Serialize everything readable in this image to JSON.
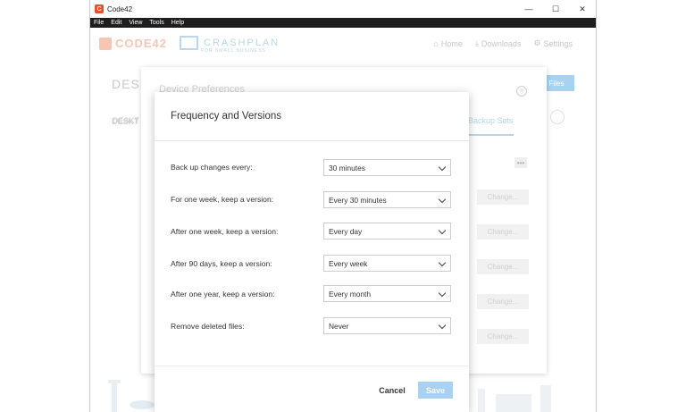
{
  "window": {
    "title": "Code42",
    "icon_label": "C",
    "controls": {
      "minimize": "—",
      "maximize": "☐",
      "close": "✕"
    }
  },
  "menu": [
    "File",
    "Edit",
    "View",
    "Tools",
    "Help"
  ],
  "header": {
    "logo": "CODE42",
    "product": "CRASHPLAN",
    "product_sub": "FOR SMALL BUSINESS",
    "nav": [
      {
        "label": "Home",
        "icon": "home-icon"
      },
      {
        "label": "Downloads",
        "icon": "download-icon"
      },
      {
        "label": "Settings",
        "icon": "gear-icon"
      }
    ]
  },
  "background": {
    "title": "DESK",
    "tab": "DESKT",
    "files_button": "Files"
  },
  "preferences": {
    "title": "Device Preferences",
    "tab_left": "DESKT",
    "tab_right": "Backup Sets",
    "dots": "•••",
    "change_label": "Change..."
  },
  "dialog": {
    "title": "Frequency and Versions",
    "rows": [
      {
        "label": "Back up changes every:",
        "value": "30 minutes"
      },
      {
        "label": "For one week, keep a version:",
        "value": "Every 30 minutes"
      },
      {
        "label": "After one week, keep a version:",
        "value": "Every day"
      },
      {
        "label": "After 90 days, keep a version:",
        "value": "Every week"
      },
      {
        "label": "After one year, keep a version:",
        "value": "Every month"
      },
      {
        "label": "Remove deleted files:",
        "value": "Never"
      }
    ],
    "cancel": "Cancel",
    "save": "Save"
  },
  "colors": {
    "accent": "#a9d1f3",
    "brand": "#e8502c"
  }
}
